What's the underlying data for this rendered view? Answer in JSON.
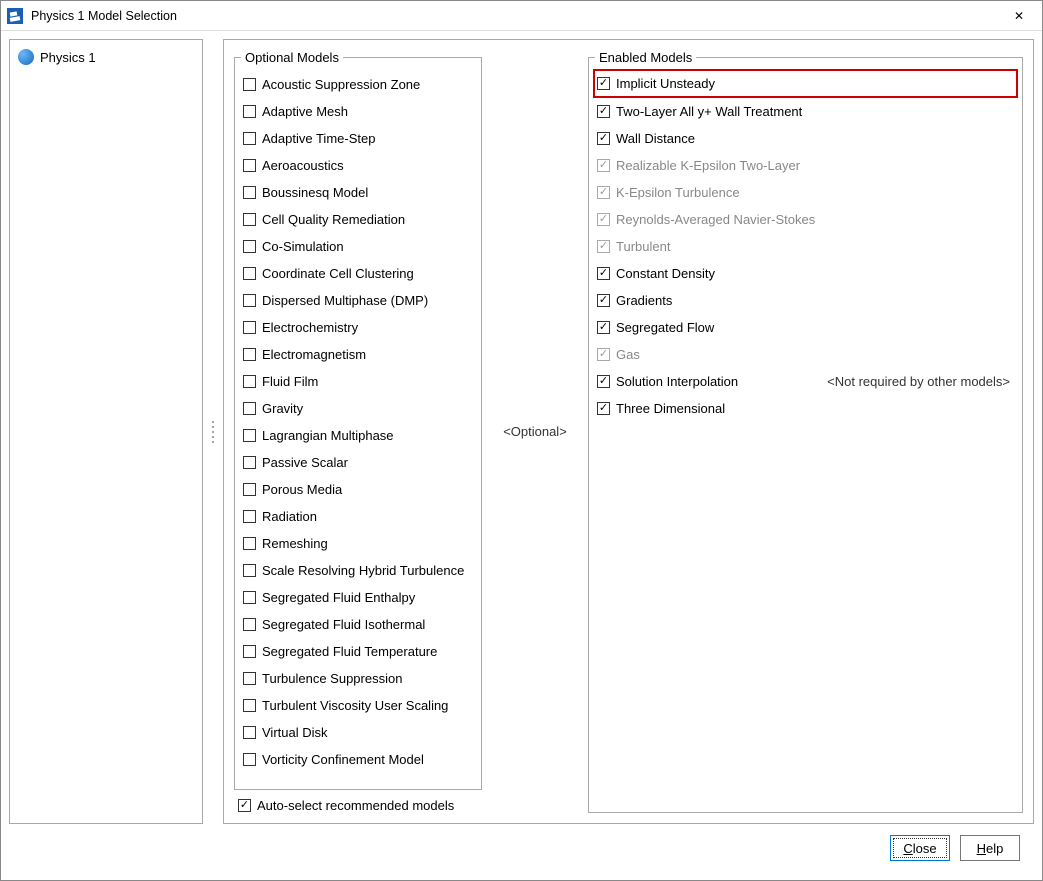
{
  "window": {
    "title": "Physics 1 Model Selection",
    "close_label": "✕"
  },
  "tree": {
    "items": [
      {
        "label": "Physics 1"
      }
    ]
  },
  "optional_legend": "Optional Models",
  "enabled_legend": "Enabled Models",
  "mid_label": "<Optional>",
  "optional_models": [
    {
      "label": "Acoustic Suppression Zone"
    },
    {
      "label": "Adaptive Mesh"
    },
    {
      "label": "Adaptive Time-Step"
    },
    {
      "label": "Aeroacoustics"
    },
    {
      "label": "Boussinesq Model"
    },
    {
      "label": "Cell Quality Remediation"
    },
    {
      "label": "Co-Simulation"
    },
    {
      "label": "Coordinate Cell Clustering"
    },
    {
      "label": "Dispersed Multiphase (DMP)"
    },
    {
      "label": "Electrochemistry"
    },
    {
      "label": "Electromagnetism"
    },
    {
      "label": "Fluid Film"
    },
    {
      "label": "Gravity"
    },
    {
      "label": "Lagrangian Multiphase"
    },
    {
      "label": "Passive Scalar"
    },
    {
      "label": "Porous Media"
    },
    {
      "label": "Radiation"
    },
    {
      "label": "Remeshing"
    },
    {
      "label": "Scale Resolving Hybrid Turbulence"
    },
    {
      "label": "Segregated Fluid Enthalpy"
    },
    {
      "label": "Segregated Fluid Isothermal"
    },
    {
      "label": "Segregated Fluid Temperature"
    },
    {
      "label": "Turbulence Suppression"
    },
    {
      "label": "Turbulent Viscosity User Scaling"
    },
    {
      "label": "Virtual Disk"
    },
    {
      "label": "Vorticity Confinement Model"
    }
  ],
  "enabled_models": [
    {
      "label": "Implicit Unsteady",
      "checked": true,
      "disabled": false,
      "highlight": true
    },
    {
      "label": "Two-Layer All y+ Wall Treatment",
      "checked": true,
      "disabled": false
    },
    {
      "label": "Wall Distance",
      "checked": true,
      "disabled": false
    },
    {
      "label": "Realizable K-Epsilon Two-Layer",
      "checked": true,
      "disabled": true
    },
    {
      "label": "K-Epsilon Turbulence",
      "checked": true,
      "disabled": true
    },
    {
      "label": "Reynolds-Averaged Navier-Stokes",
      "checked": true,
      "disabled": true
    },
    {
      "label": "Turbulent",
      "checked": true,
      "disabled": true
    },
    {
      "label": "Constant Density",
      "checked": true,
      "disabled": false
    },
    {
      "label": "Gradients",
      "checked": true,
      "disabled": false
    },
    {
      "label": "Segregated Flow",
      "checked": true,
      "disabled": false
    },
    {
      "label": "Gas",
      "checked": true,
      "disabled": true
    },
    {
      "label": "Solution Interpolation",
      "checked": true,
      "disabled": false,
      "note": "<Not required by other models>"
    },
    {
      "label": "Three Dimensional",
      "checked": true,
      "disabled": false
    }
  ],
  "auto_select": {
    "label": "Auto-select recommended models",
    "checked": true
  },
  "footer": {
    "close": "Close",
    "help": "Help"
  }
}
